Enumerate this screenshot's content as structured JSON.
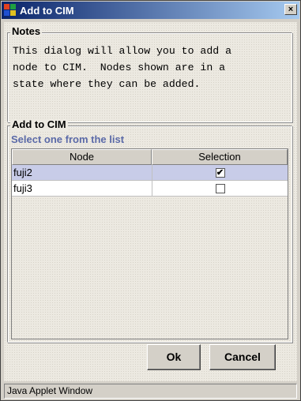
{
  "window": {
    "title": "Add to CIM",
    "close_glyph": "×"
  },
  "notes": {
    "title": "Notes",
    "text": "This dialog will allow you to add a\nnode to CIM.  Nodes shown are in a\nstate where they can be added."
  },
  "add_to_cim": {
    "title": "Add to CIM",
    "subtitle": "Select one from the list",
    "columns": [
      "Node",
      "Selection"
    ],
    "rows": [
      {
        "node": "fuji2",
        "selected": true,
        "mark": "✔"
      },
      {
        "node": "fuji3",
        "selected": false,
        "mark": ""
      }
    ]
  },
  "buttons": {
    "ok": "Ok",
    "cancel": "Cancel"
  },
  "status_bar": {
    "text": "Java Applet Window"
  },
  "colors": {
    "title_start": "#0a246a",
    "title_end": "#a6caf0",
    "subtitle": "#5b6aa8",
    "selected_row": "#c8cce8"
  },
  "icons": {
    "app": "java-app-icon",
    "close": "close-icon",
    "check": "checkmark-icon"
  }
}
